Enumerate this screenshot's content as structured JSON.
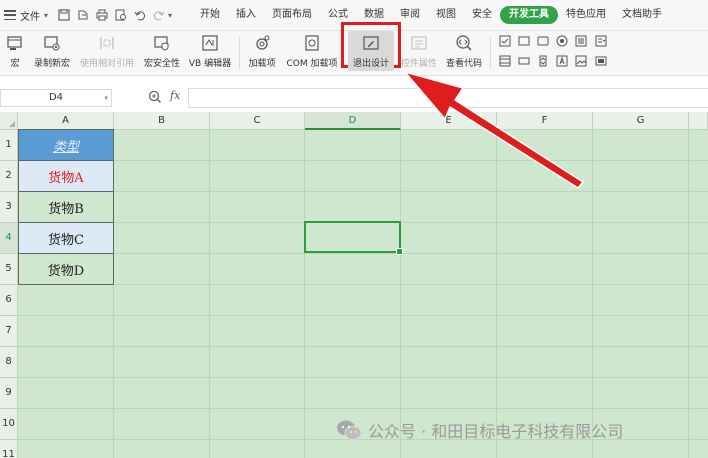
{
  "menubar": {
    "file_label": "文件",
    "tabs": [
      "开始",
      "插入",
      "页面布局",
      "公式",
      "数据",
      "审阅",
      "视图",
      "安全",
      "开发工具",
      "特色应用",
      "文档助手"
    ],
    "active_tab": "开发工具",
    "accent_color": "#2fa24a"
  },
  "ribbon": {
    "items": [
      {
        "label": "宏",
        "icon": "macro-icon"
      },
      {
        "label": "录制新宏",
        "icon": "record-macro-icon"
      },
      {
        "label": "使用相对引用",
        "icon": "relative-ref-icon",
        "disabled": true
      },
      {
        "label": "宏安全性",
        "icon": "macro-security-icon"
      },
      {
        "label": "VB 编辑器",
        "icon": "vb-editor-icon"
      },
      {
        "label": "加载项",
        "icon": "addins-icon"
      },
      {
        "label": "COM 加载项",
        "icon": "com-addins-icon"
      },
      {
        "label": "退出设计",
        "icon": "exit-design-icon",
        "pressed": true
      },
      {
        "label": "控件属性",
        "icon": "control-properties-icon",
        "disabled": true
      },
      {
        "label": "查看代码",
        "icon": "view-code-icon"
      }
    ],
    "highlight_color": "#e01d1d"
  },
  "formula": {
    "name_box": "D4",
    "fx": "fx",
    "content": ""
  },
  "sheet": {
    "columns": [
      "A",
      "B",
      "C",
      "D",
      "E",
      "F",
      "G"
    ],
    "selected_column": "D",
    "rows": [
      "1",
      "2",
      "3",
      "4",
      "5",
      "6",
      "7",
      "8",
      "9",
      "10",
      "11"
    ],
    "selected_row": "4",
    "active_cell": "D4",
    "cells_A": [
      "类型",
      "货物A",
      "货物B",
      "货物C",
      "货物D"
    ],
    "background": "#cfe6cf"
  },
  "watermark": {
    "text": "公众号 · 和田目标电子科技有限公司"
  }
}
